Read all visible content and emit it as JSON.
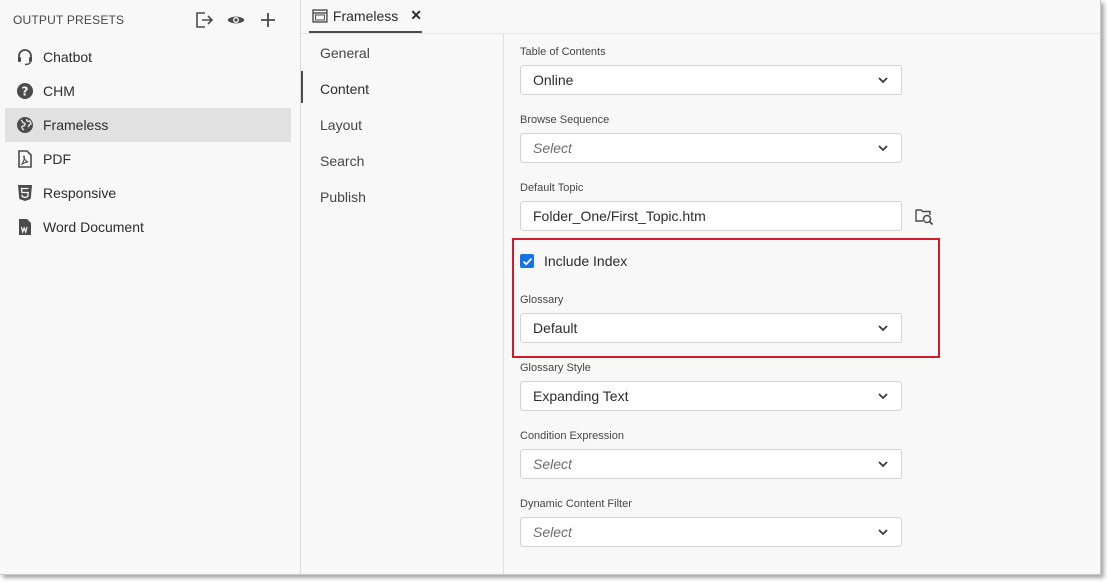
{
  "sidebar": {
    "header": "OUTPUT PRESETS",
    "items": [
      {
        "label": "Chatbot",
        "icon": "headset-icon"
      },
      {
        "label": "CHM",
        "icon": "help-circle-icon"
      },
      {
        "label": "Frameless",
        "icon": "globe-icon",
        "selected": true
      },
      {
        "label": "PDF",
        "icon": "pdf-icon"
      },
      {
        "label": "Responsive",
        "icon": "html5-icon"
      },
      {
        "label": "Word Document",
        "icon": "word-doc-icon"
      }
    ]
  },
  "tab": {
    "label": "Frameless",
    "close": "✕"
  },
  "nav": {
    "items": [
      "General",
      "Content",
      "Layout",
      "Search",
      "Publish"
    ],
    "active": "Content"
  },
  "form": {
    "toc_label": "Table of Contents",
    "toc_value": "Online",
    "browse_label": "Browse Sequence",
    "browse_placeholder": "Select",
    "default_topic_label": "Default Topic",
    "default_topic_value": "Folder_One/First_Topic.htm",
    "include_index_label": "Include Index",
    "include_index_checked": true,
    "glossary_label": "Glossary",
    "glossary_value": "Default",
    "glossary_style_label": "Glossary Style",
    "glossary_style_value": "Expanding Text",
    "condition_label": "Condition Expression",
    "condition_placeholder": "Select",
    "dynamic_label": "Dynamic Content Filter",
    "dynamic_placeholder": "Select"
  },
  "colors": {
    "accent": "#1473e6",
    "highlight": "#d3192c",
    "selected_bg": "#e1e1e1"
  }
}
